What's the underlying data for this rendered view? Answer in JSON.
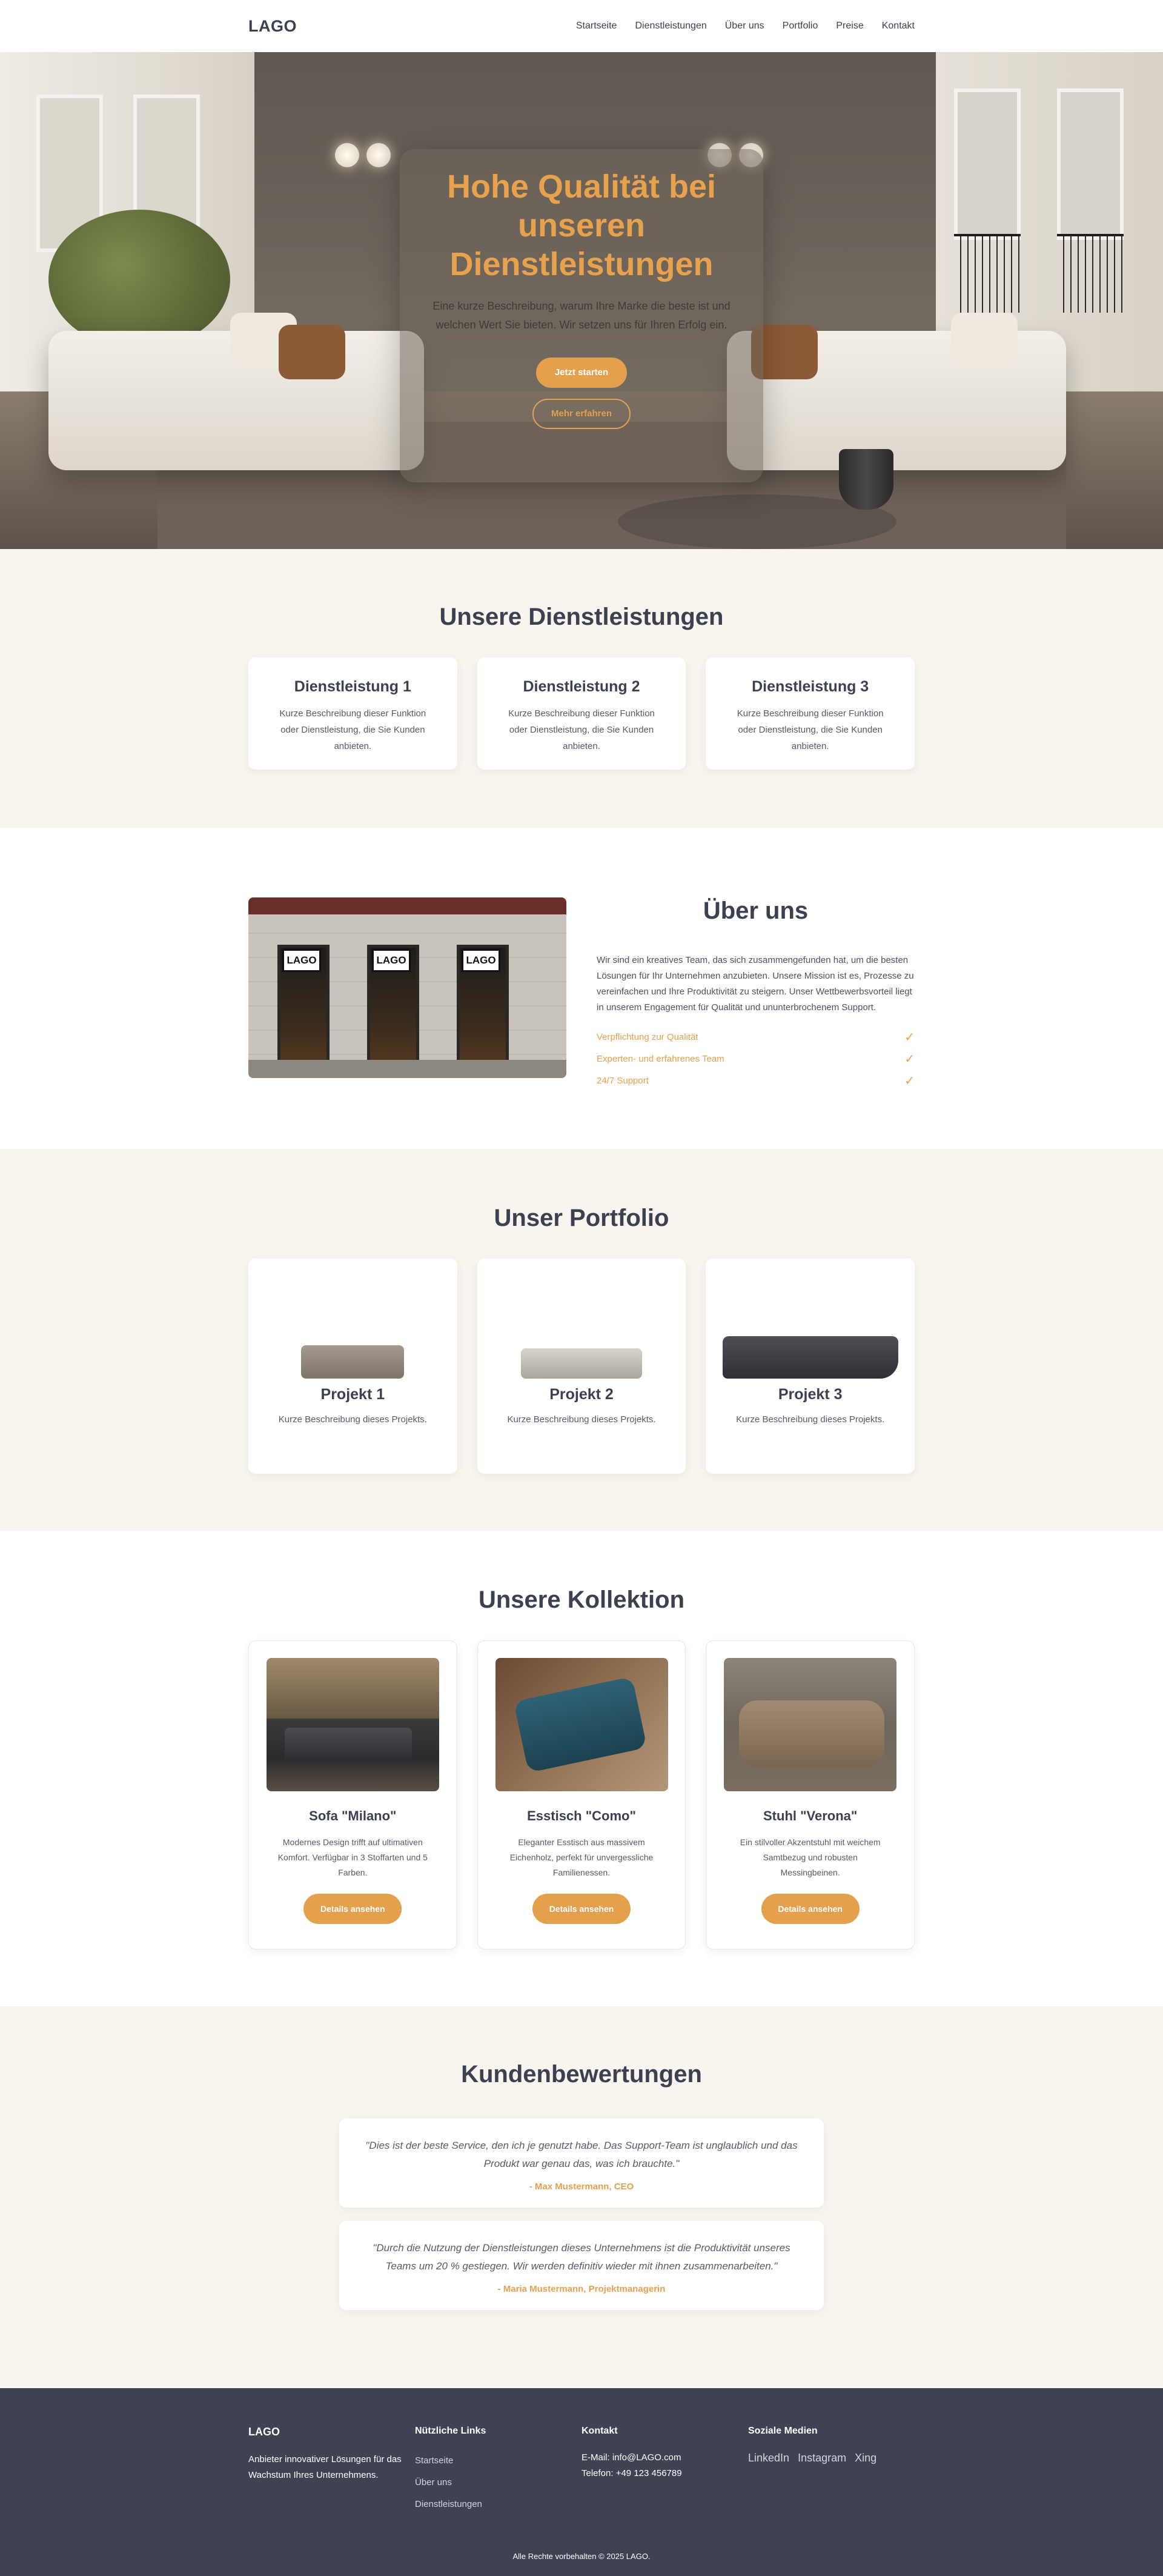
{
  "header": {
    "logo": "LAGO",
    "nav": [
      "Startseite",
      "Dienstleistungen",
      "Über uns",
      "Portfolio",
      "Preise",
      "Kontakt"
    ]
  },
  "hero": {
    "title": "Hohe Qualität bei unseren Dienstleistungen",
    "description": "Eine kurze Beschreibung, warum Ihre Marke die beste ist und welchen Wert Sie bieten. Wir setzen uns für Ihren Erfolg ein.",
    "primary_button": "Jetzt starten",
    "secondary_button": "Mehr erfahren"
  },
  "services": {
    "title": "Unsere Dienstleistungen",
    "items": [
      {
        "title": "Dienstleistung 1",
        "text": "Kurze Beschreibung dieser Funktion oder Dienstleistung, die Sie Kunden anbieten."
      },
      {
        "title": "Dienstleistung 2",
        "text": "Kurze Beschreibung dieser Funktion oder Dienstleistung, die Sie Kunden anbieten."
      },
      {
        "title": "Dienstleistung 3",
        "text": "Kurze Beschreibung dieser Funktion oder Dienstleistung, die Sie Kunden anbieten."
      }
    ]
  },
  "about": {
    "title": "Über uns",
    "image_sign": "LAGO",
    "paragraph": "Wir sind ein kreatives Team, das sich zusammengefunden hat, um die besten Lösungen für Ihr Unternehmen anzubieten. Unsere Mission ist es, Prozesse zu vereinfachen und Ihre Produktivität zu steigern. Unser Wettbewerbsvorteil liegt in unserem Engagement für Qualität und ununterbrochenem Support.",
    "features": [
      "Verpflichtung zur Qualität",
      "Experten- und erfahrenes Team",
      "24/7 Support"
    ],
    "check": "✓"
  },
  "portfolio": {
    "title": "Unser Portfolio",
    "items": [
      {
        "title": "Projekt 1",
        "text": "Kurze Beschreibung dieses Projekts."
      },
      {
        "title": "Projekt 2",
        "text": "Kurze Beschreibung dieses Projekts."
      },
      {
        "title": "Projekt 3",
        "text": "Kurze Beschreibung dieses Projekts."
      }
    ]
  },
  "collection": {
    "title": "Unsere Kollektion",
    "button": "Details ansehen",
    "items": [
      {
        "title": "Sofa \"Milano\"",
        "text": "Modernes Design trifft auf ultimativen Komfort. Verfügbar in 3 Stoffarten und 5 Farben."
      },
      {
        "title": "Esstisch \"Como\"",
        "text": "Eleganter Esstisch aus massivem Eichenholz, perfekt für unvergessliche Familienessen."
      },
      {
        "title": "Stuhl \"Verona\"",
        "text": "Ein stilvoller Akzentstuhl mit weichem Samtbezug und robusten Messingbeinen."
      }
    ]
  },
  "reviews": {
    "title": "Kundenbewertungen",
    "items": [
      {
        "quote": "\"Dies ist der beste Service, den ich je genutzt habe. Das Support-Team ist unglaublich und das Produkt war genau das, was ich brauchte.\"",
        "author": "- Max Mustermann, CEO"
      },
      {
        "quote": "\"Durch die Nutzung der Dienstleistungen dieses Unternehmens ist die Produktivität unseres Teams um 20 % gestiegen. Wir werden definitiv wieder mit ihnen zusammenarbeiten.\"",
        "author": "- Maria Mustermann, Projektmanagerin"
      }
    ]
  },
  "footer": {
    "brand": "LAGO",
    "tagline": "Anbieter innovativer Lösungen für das Wachstum Ihres Unternehmens.",
    "links_title": "Nützliche Links",
    "links": [
      "Startseite",
      "Über uns",
      "Dienstleistungen"
    ],
    "contact_title": "Kontakt",
    "email": "E-Mail: info@LAGO.com",
    "phone": "Telefon: +49 123 456789",
    "social_title": "Soziale Medien",
    "social": [
      "LinkedIn",
      "Instagram",
      "Xing"
    ],
    "copyright": "Alle Rechte vorbehalten © 2025 LAGO."
  },
  "colors": {
    "accent": "#e5a04e",
    "text": "#3b4151",
    "section_bg": "#f8f5ef",
    "footer_bg": "#3e4253"
  }
}
